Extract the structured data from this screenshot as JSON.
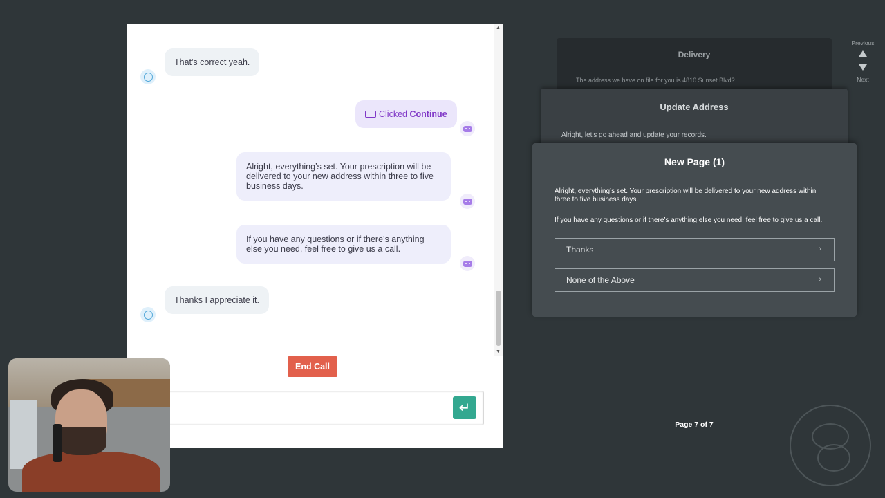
{
  "chat": {
    "messages": [
      {
        "role": "user",
        "text": "That's correct yeah."
      },
      {
        "role": "action",
        "prefix": "Clicked",
        "action": "Continue"
      },
      {
        "role": "bot",
        "text": "Alright, everything’s set. Your prescription will be delivered to your new address within three to five business days."
      },
      {
        "role": "bot",
        "text": "If you have any questions or if there’s anything else you need, feel free to give us a call."
      },
      {
        "role": "user",
        "text": "Thanks I appreciate it."
      }
    ],
    "end_call_label": "End Call",
    "input_placeholder": "",
    "send_icon": "return-arrow-icon"
  },
  "flow": {
    "cards": [
      {
        "title": "Delivery",
        "text": "The address we have on file for you is 4810 Sunset Blvd?"
      },
      {
        "title": "Update Address",
        "text": "Alright, let's go ahead and update your records."
      },
      {
        "title": "New Page (1)",
        "text1": "Alright, everything’s set. Your prescription will be delivered to your new address within three to five business days.",
        "text2": "If you have any questions or if there’s anything else you need, feel free to give us a call.",
        "options": [
          "Thanks",
          "None of the Above"
        ]
      }
    ],
    "nav": {
      "previous": "Previous",
      "next": "Next"
    },
    "page_indicator": "Page 7 of 7"
  },
  "colors": {
    "background": "#2f3639",
    "end_call": "#e2604c",
    "send_button": "#33a890",
    "action_text": "#8038c7"
  }
}
